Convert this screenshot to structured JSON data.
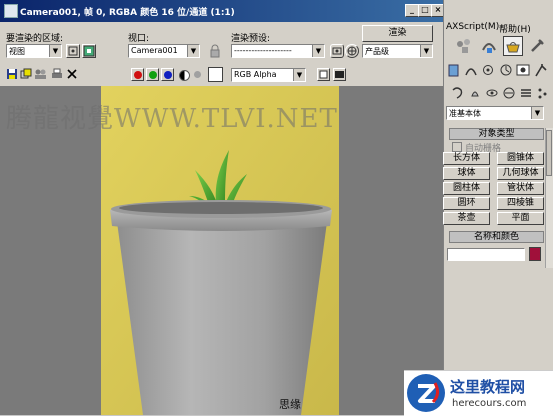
{
  "window": {
    "title": "Camera001, 帧 0, RGBA 颜色 16 位/通道 (1:1)",
    "buttons": {
      "minimize": "_",
      "maximize": "□",
      "close": "×"
    }
  },
  "toolbar": {
    "area_label": "要渲染的区域:",
    "area_value": "视图",
    "viewport_label": "视口:",
    "viewport_value": "Camera001",
    "preset_label": "渲染预设:",
    "preset_value": "--------------------",
    "render_label": "渲染",
    "render_mode_value": "产品级",
    "channel_value": "RGB Alpha"
  },
  "viewport": {
    "watermark": "腾龍视覺WWW.TLVI.NET",
    "corner_text": "思缘"
  },
  "command_panel": {
    "menu_left": "AXScript(M)",
    "menu_right": "帮助(H)",
    "category_value": "准基本体",
    "object_type_header": "对象类型",
    "auto_grid_label": "自动栅格",
    "object_types": [
      "长方体",
      "圆锥体",
      "球体",
      "几何球体",
      "圆柱体",
      "管状体",
      "圆环",
      "四棱锥",
      "茶壶",
      "平面"
    ],
    "name_color_header": "名称和颜色",
    "swatch_color": "#a0103a"
  },
  "colors": {
    "title_start": "#0a246a",
    "title_end": "#3a6ea5",
    "background_yellow": "#d4c454",
    "pot_gray": "#a8a8a8",
    "leaf_green": "#3c9a28"
  },
  "logo": {
    "name": "这里教程网",
    "url": "herecours.com"
  }
}
